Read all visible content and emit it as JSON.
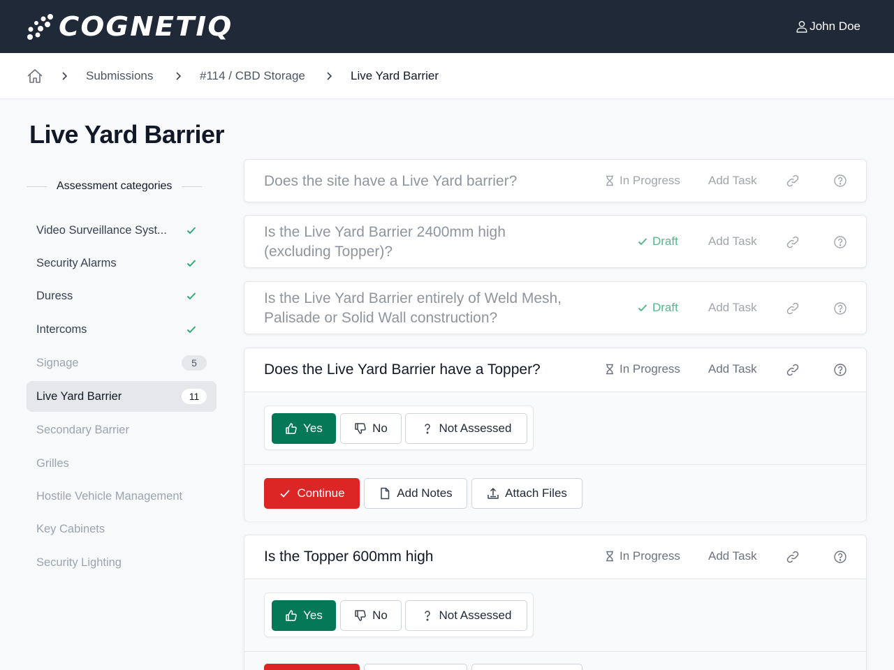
{
  "header": {
    "logo_text": "COGNETIQ",
    "user_name": "John Doe"
  },
  "breadcrumb": {
    "items": [
      "Submissions",
      "#114 / CBD Storage",
      "Live Yard Barrier"
    ]
  },
  "page": {
    "title": "Live Yard Barrier"
  },
  "sidebar": {
    "heading": "Assessment categories",
    "items": [
      {
        "label": "Video Surveillance Syst...",
        "state": "complete"
      },
      {
        "label": "Security Alarms",
        "state": "complete"
      },
      {
        "label": "Duress",
        "state": "complete"
      },
      {
        "label": "Intercoms",
        "state": "complete"
      },
      {
        "label": "Signage",
        "state": "count",
        "count": "5"
      },
      {
        "label": "Live Yard Barrier",
        "state": "active",
        "count": "11"
      },
      {
        "label": "Secondary Barrier",
        "state": "pending"
      },
      {
        "label": "Grilles",
        "state": "pending"
      },
      {
        "label": "Hostile Vehicle Management",
        "state": "pending"
      },
      {
        "label": "Key Cabinets",
        "state": "pending"
      },
      {
        "label": "Security Lighting",
        "state": "pending"
      }
    ]
  },
  "questions": [
    {
      "text": "Does the site have a Live Yard barrier?",
      "status": "In Progress",
      "add_task": "Add Task"
    },
    {
      "text": "Is the Live Yard Barrier 2400mm high (excluding Topper)?",
      "status": "Draft",
      "add_task": "Add Task"
    },
    {
      "text": "Is the Live Yard Barrier entirely of Weld Mesh, Palisade or Solid Wall construction?",
      "status": "Draft",
      "add_task": "Add Task"
    },
    {
      "text": "Does the Live Yard Barrier have a Topper?",
      "status": "In Progress",
      "add_task": "Add Task"
    },
    {
      "text": "Is the Topper 600mm high",
      "status": "In Progress",
      "add_task": "Add Task"
    }
  ],
  "answers": {
    "yes": "Yes",
    "no": "No",
    "not_assessed": "Not Assessed",
    "selected": "Yes"
  },
  "actions": {
    "continue": "Continue",
    "add_notes": "Add Notes",
    "attach_files": "Attach Files"
  },
  "colors": {
    "header_bg": "#1f2937",
    "yes_green": "#047857",
    "continue_red": "#dc2626",
    "check_green": "#34a870"
  }
}
